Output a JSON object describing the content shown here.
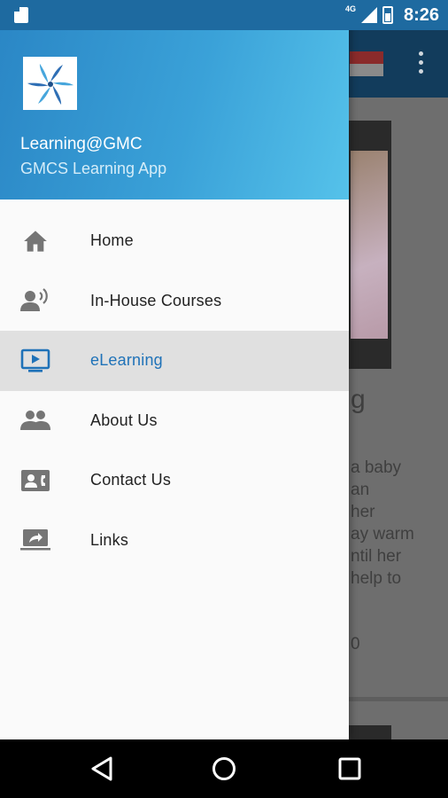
{
  "status_bar": {
    "network": "4G",
    "time": "8:26"
  },
  "background_app": {
    "heading_fragment": "g",
    "text_fragments": [
      "a baby",
      "an",
      "her",
      "ay warm",
      "ntil her",
      " help to"
    ],
    "number_fragment": "0"
  },
  "drawer": {
    "app_name": "Learning@GMC",
    "app_subtitle": "GMCS Learning App",
    "accent_color": "#1f72b8",
    "items": [
      {
        "label": "Home",
        "icon": "home-icon",
        "active": false
      },
      {
        "label": "In-House Courses",
        "icon": "speaking-person-icon",
        "active": false
      },
      {
        "label": "eLearning",
        "icon": "video-screen-icon",
        "active": true
      },
      {
        "label": "About Us",
        "icon": "group-icon",
        "active": false
      },
      {
        "label": "Contact Us",
        "icon": "contact-card-icon",
        "active": false
      },
      {
        "label": "Links",
        "icon": "share-screen-icon",
        "active": false
      }
    ]
  },
  "nav_bar": {
    "buttons": [
      "back",
      "home",
      "recents"
    ]
  }
}
